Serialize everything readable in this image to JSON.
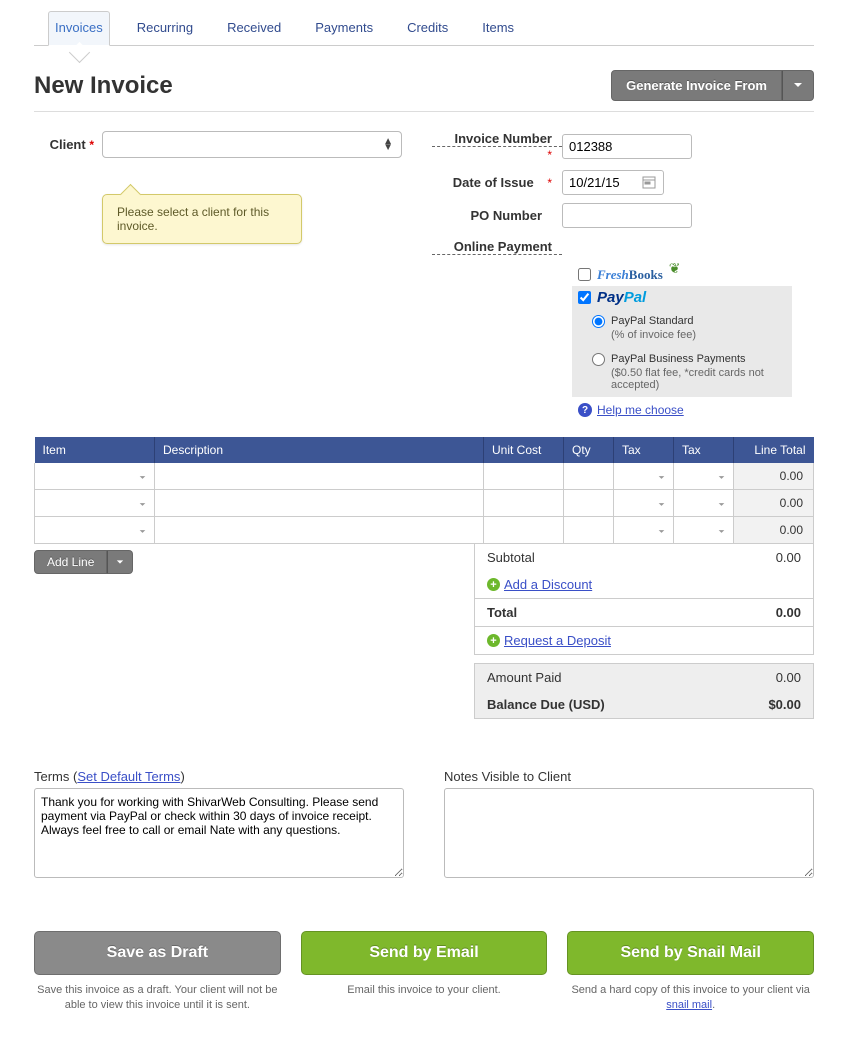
{
  "tabs": [
    "Invoices",
    "Recurring",
    "Received",
    "Payments",
    "Credits",
    "Items"
  ],
  "page_title": "New Invoice",
  "generate_btn": "Generate Invoice From",
  "client_label": "Client",
  "client_tooltip": "Please select a client for this invoice.",
  "fields": {
    "invoice_number_label": "Invoice Number",
    "invoice_number_value": "012388",
    "date_label": "Date of Issue",
    "date_value": "10/21/15",
    "po_label": "PO Number",
    "po_value": "",
    "online_payment_label": "Online Payment"
  },
  "payment": {
    "freshbooks": "FreshBooks",
    "paypal": "PayPal",
    "standard_label": "PayPal Standard",
    "standard_detail": "(% of invoice fee)",
    "business_label": "PayPal Business Payments",
    "business_detail": "($0.50 flat fee, *credit cards not accepted)",
    "help_link": "Help me choose"
  },
  "table": {
    "headers": [
      "Item",
      "Description",
      "Unit Cost",
      "Qty",
      "Tax",
      "Tax",
      "Line Total"
    ],
    "line_total_default": "0.00"
  },
  "add_line_btn": "Add Line",
  "totals": {
    "subtotal_label": "Subtotal",
    "subtotal_value": "0.00",
    "add_discount": "Add a Discount",
    "total_label": "Total",
    "total_value": "0.00",
    "deposit": "Request a Deposit",
    "amount_paid_label": "Amount Paid",
    "amount_paid_value": "0.00",
    "balance_label": "Balance Due (USD)",
    "balance_value": "$0.00"
  },
  "terms": {
    "label": "Terms (",
    "link": "Set Default Terms",
    "label_close": ")",
    "text": "Thank you for working with ShivarWeb Consulting. Please send payment via PayPal or check within 30 days of invoice receipt. Always feel free to call or email Nate with any questions."
  },
  "notes_label": "Notes Visible to Client",
  "actions": {
    "draft_btn": "Save as Draft",
    "draft_desc": "Save this invoice as a draft. Your client will not be able to view this invoice until it is sent.",
    "email_btn": "Send by Email",
    "email_desc": "Email this invoice to your client.",
    "snail_btn": "Send by Snail Mail",
    "snail_desc_pre": "Send a hard copy of this invoice to your client via ",
    "snail_link": "snail mail",
    "snail_desc_post": "."
  }
}
